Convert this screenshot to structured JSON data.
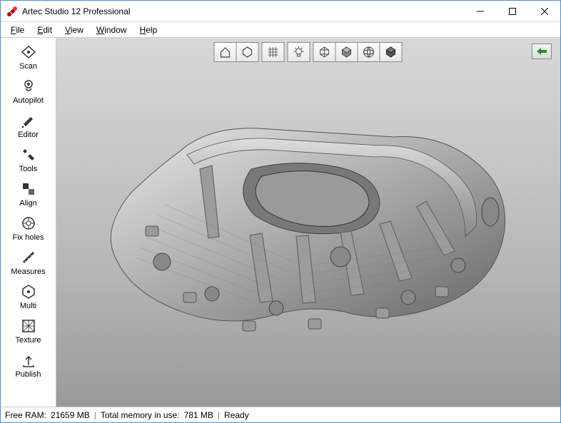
{
  "titlebar": {
    "title": "Artec Studio 12 Professional"
  },
  "menu": {
    "file": "File",
    "edit": "Edit",
    "view": "View",
    "window": "Window",
    "help": "Help"
  },
  "sidebar": {
    "scan": "Scan",
    "autopilot": "Autopilot",
    "editor": "Editor",
    "tools": "Tools",
    "align": "Align",
    "fixholes": "Fix holes",
    "measures": "Measures",
    "multi": "Multi",
    "texture": "Texture",
    "publish": "Publish"
  },
  "toptoolbar": {
    "home": "home-icon",
    "fit": "fit-view-icon",
    "grid": "grid-icon",
    "light": "light-icon",
    "wireframe": "wireframe-icon",
    "solid": "solid-icon",
    "smooth": "smooth-shade-icon",
    "textured": "textured-icon"
  },
  "back": "back-icon",
  "status": {
    "ram_label": "Free RAM:",
    "ram_value": "21659 MB",
    "mem_label": "Total memory in use:",
    "mem_value": "781 MB",
    "state": "Ready"
  }
}
